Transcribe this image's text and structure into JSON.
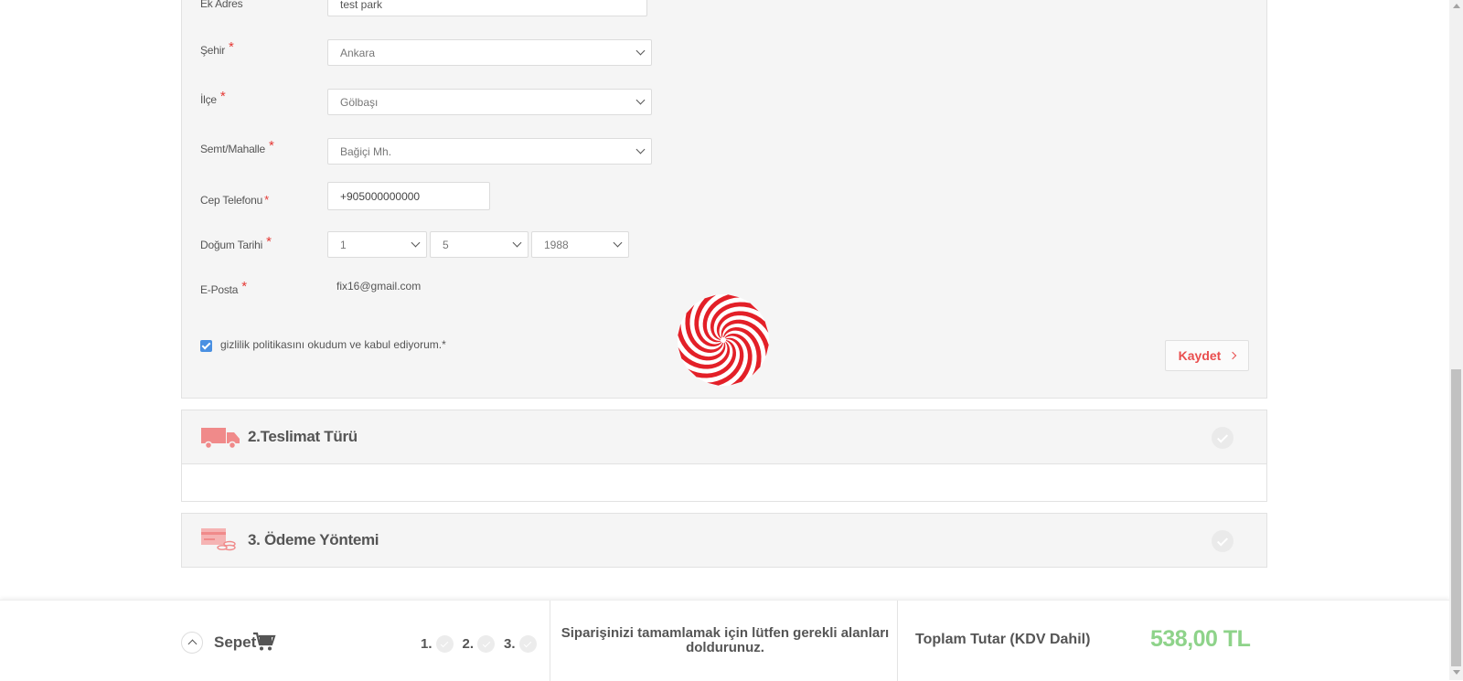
{
  "form": {
    "ek_adres": {
      "label": "Ek Adres",
      "value": "test park"
    },
    "sehir": {
      "label": "Şehir",
      "required_mark": "*",
      "value": "Ankara"
    },
    "ilce": {
      "label": "İlçe",
      "required_mark": "*",
      "value": "Gölbaşı"
    },
    "semt": {
      "label": "Semt/Mahalle",
      "required_mark": "*",
      "value": "Bağiçi Mh."
    },
    "phone": {
      "label": "Cep Telefonu",
      "required_mark": "*",
      "value": "+905000000000"
    },
    "birth": {
      "label": "Doğum Tarihi",
      "required_mark": "*",
      "day": "1",
      "month": "5",
      "year": "1988"
    },
    "email": {
      "label": "E-Posta",
      "required_mark": "*",
      "value": "fix16@gmail.com"
    },
    "consent": {
      "text": "gizlilik politikasını okudum ve kabul ediyorum.*",
      "checked": true
    },
    "save_label": "Kaydet"
  },
  "sections": {
    "delivery": {
      "title": "2.Teslimat Türü",
      "icon": "truck-icon"
    },
    "payment": {
      "title": "3. Ödeme Yöntemi",
      "icon": "payment-card-icon"
    }
  },
  "bottom_bar": {
    "cart_label": "Sepet",
    "steps": [
      "1.",
      "2.",
      "3."
    ],
    "notice": "Siparişinizi tamamlamak için lütfen gerekli alanları doldurunuz.",
    "total_label": "Toplam Tutar (KDV Dahil)",
    "total_value": "538,00 TL"
  },
  "colors": {
    "accent": "#e94e4e",
    "icon_red": "#f08a8a",
    "total_green": "#8ed38a",
    "checkbox_blue": "#4a90e2"
  }
}
